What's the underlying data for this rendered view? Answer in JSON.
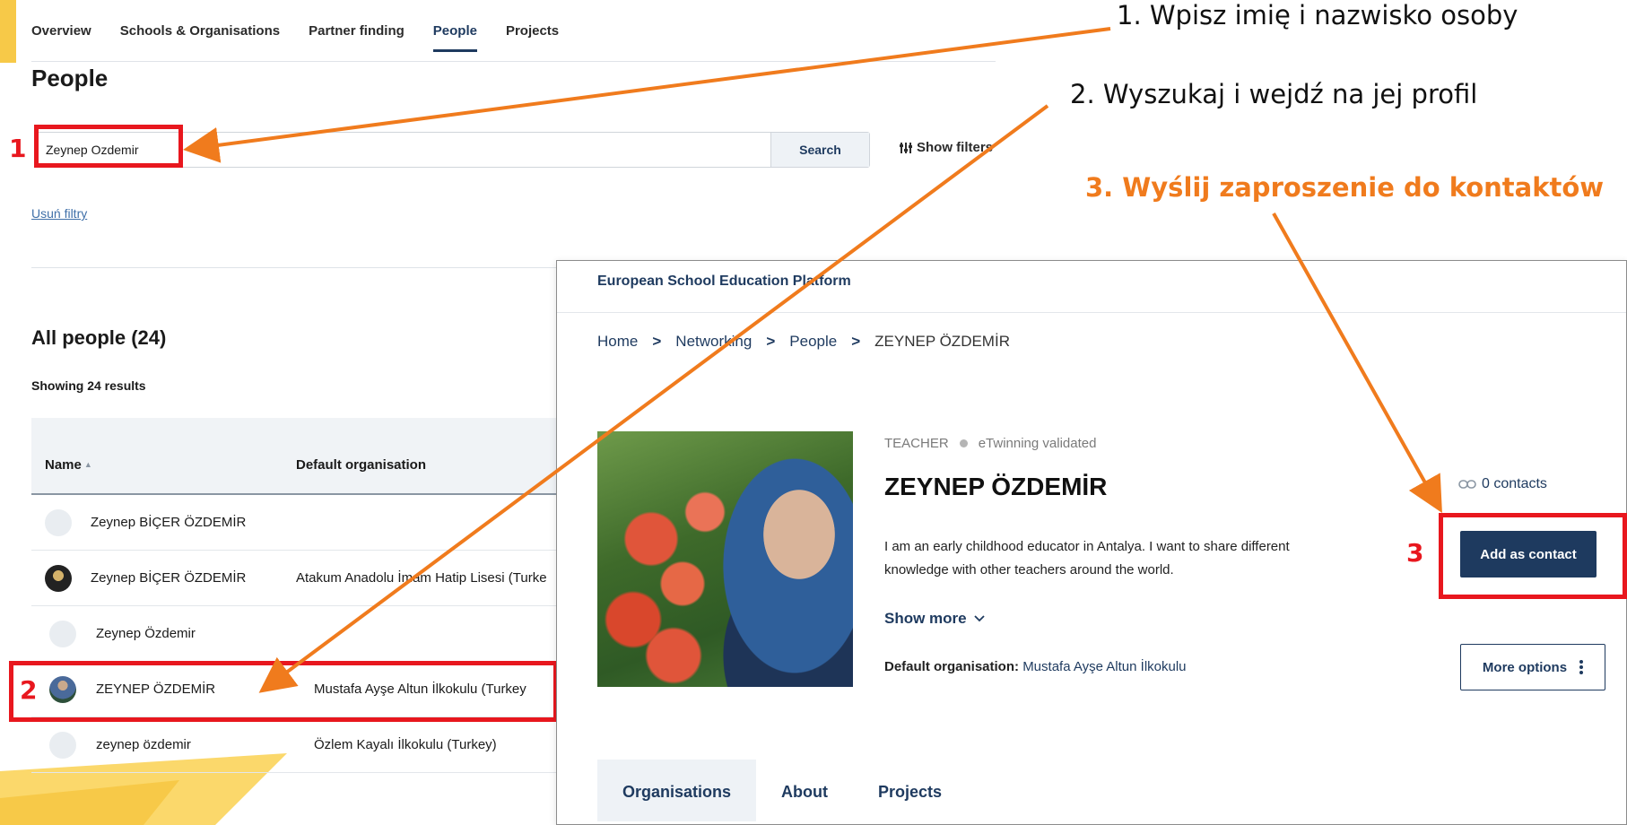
{
  "nav": {
    "tabs": [
      "Overview",
      "Schools & Organisations",
      "Partner finding",
      "People",
      "Projects"
    ],
    "active": "People"
  },
  "search_page": {
    "title": "People",
    "search_value": "Zeynep Ozdemir",
    "search_button": "Search",
    "filters_button": "Show filters",
    "filters_icon": "sliders-icon",
    "clear_filters": "Usuń filtry",
    "results_title": "All people (24)",
    "showing": "Showing 24 results",
    "columns": [
      "Name",
      "Default organisation"
    ],
    "sort_indicator": "▲",
    "rows": [
      {
        "name": "Zeynep BİÇER ÖZDEMİR",
        "org": ""
      },
      {
        "name": "Zeynep BİÇER ÖZDEMİR",
        "org": "Atakum Anadolu İmam Hatip Lisesi (Turke"
      },
      {
        "name": "Zeynep Özdemir",
        "org": ""
      },
      {
        "name": "ZEYNEP ÖZDEMİR",
        "org": "Mustafa Ayşe Altun İlkokulu (Turkey"
      },
      {
        "name": "zeynep özdemir",
        "org": "Özlem Kayalı İlkokulu (Turkey)"
      }
    ]
  },
  "profile": {
    "brand": "European School Education Platform",
    "breadcrumb": [
      "Home",
      "Networking",
      "People",
      "ZEYNEP ÖZDEMİR"
    ],
    "breadcrumb_sep": ">",
    "role": "TEACHER",
    "validated": "eTwinning validated",
    "name": "ZEYNEP ÖZDEMİR",
    "contacts": "0 contacts",
    "bio": "I am an early childhood educator in Antalya. I want to share different knowledge with other teachers around the world.",
    "show_more": "Show more",
    "default_org_label": "Default organisation:",
    "default_org_value": "Mustafa Ayşe Altun İlkokulu",
    "add_contact": "Add as contact",
    "more_options": "More options",
    "tabs": [
      "Organisations",
      "About",
      "Projects"
    ]
  },
  "annotations": {
    "step1": "1. Wpisz imię i nazwisko osoby",
    "step2": "2. Wyszukaj i wejdź na jej profil",
    "step3": "3. Wyślij zaproszenie do kontaktów",
    "marker1": "1",
    "marker2": "2",
    "marker3": "3",
    "highlight_color": "#e8171e",
    "arrow_color": "#f07b1d"
  }
}
